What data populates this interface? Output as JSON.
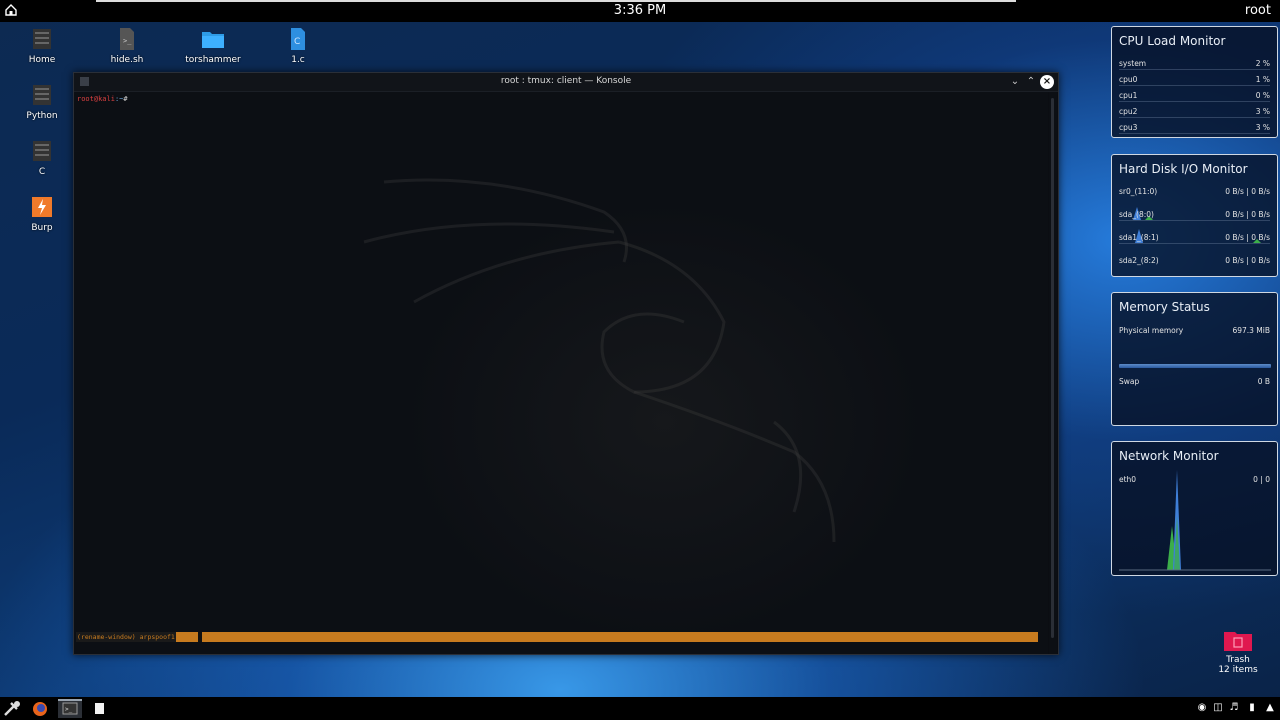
{
  "top_panel": {
    "clock": "3:36 PM",
    "user": "root"
  },
  "desktop_icons": [
    {
      "label": "Home"
    },
    {
      "label": "hide.sh"
    },
    {
      "label": "torshammer"
    },
    {
      "label": "1.c"
    },
    {
      "label": "Python"
    },
    {
      "label": "C"
    },
    {
      "label": "Burp"
    }
  ],
  "konsole": {
    "title": "root : tmux: client — Konsole",
    "prompt_user": "root@kali",
    "prompt_path": ":~",
    "prompt_symbol": "#",
    "tmux_command": "(rename-window) arpspoof1"
  },
  "cpu_widget": {
    "title": "CPU Load Monitor",
    "rows": [
      {
        "label": "system",
        "value": "2 %"
      },
      {
        "label": "cpu0",
        "value": "1 %"
      },
      {
        "label": "cpu1",
        "value": "0 %"
      },
      {
        "label": "cpu2",
        "value": "3 %"
      },
      {
        "label": "cpu3",
        "value": "3 %"
      }
    ]
  },
  "disk_widget": {
    "title": "Hard Disk I/O Monitor",
    "rows": [
      {
        "label": "sr0_(11:0)",
        "value": "0 B/s | 0 B/s"
      },
      {
        "label": "sda_(8:0)",
        "value": "0 B/s | 0 B/s"
      },
      {
        "label": "sda1_(8:1)",
        "value": "0 B/s | 0 B/s"
      },
      {
        "label": "sda2_(8:2)",
        "value": "0 B/s | 0 B/s"
      }
    ]
  },
  "memory_widget": {
    "title": "Memory Status",
    "physical_label": "Physical memory",
    "physical_value": "697.3 MiB",
    "swap_label": "Swap",
    "swap_value": "0 B"
  },
  "network_widget": {
    "title": "Network Monitor",
    "interface": "eth0",
    "value": "0 | 0"
  },
  "trash": {
    "label": "Trash",
    "count": "12 items"
  },
  "colors": {
    "tmux_status": "#c77b1f",
    "prompt_user": "#d94040",
    "prompt_path": "#6fa8dc",
    "trash": "#e0184f"
  }
}
